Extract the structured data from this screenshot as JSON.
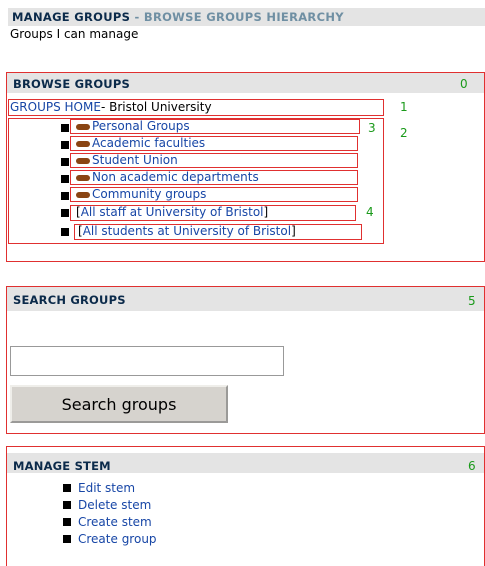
{
  "page": {
    "title_main": "MANAGE GROUPS",
    "title_sep": " - ",
    "title_sub": "BROWSE GROUPS HIERARCHY",
    "subtitle": "Groups I can manage"
  },
  "browse": {
    "title": "BROWSE GROUPS",
    "number": "0",
    "home_link": "GROUPS HOME",
    "home_suffix": "- Bristol University",
    "home_number": "1",
    "items_number": "2",
    "first_item_number": "3",
    "bracket_number": "4",
    "items": [
      {
        "label": "Personal Groups"
      },
      {
        "label": "Academic faculties"
      },
      {
        "label": "Student Union"
      },
      {
        "label": "Non academic departments"
      },
      {
        "label": "Community groups"
      }
    ],
    "bracket_items": [
      {
        "label": "All staff at University of Bristol"
      },
      {
        "label": "All students at University of Bristol"
      }
    ]
  },
  "search": {
    "title": "SEARCH GROUPS",
    "number": "5",
    "input_value": "",
    "button_label": "Search groups"
  },
  "manage": {
    "title": "MANAGE STEM",
    "number": "6",
    "items": [
      {
        "label": "Edit stem"
      },
      {
        "label": "Delete stem"
      },
      {
        "label": "Create stem"
      },
      {
        "label": "Create group"
      }
    ]
  },
  "colors": {
    "accent_red": "#e03030",
    "link_blue": "#1746a6",
    "number_green": "#1a9a1a",
    "pill_brown": "#8a4513"
  }
}
